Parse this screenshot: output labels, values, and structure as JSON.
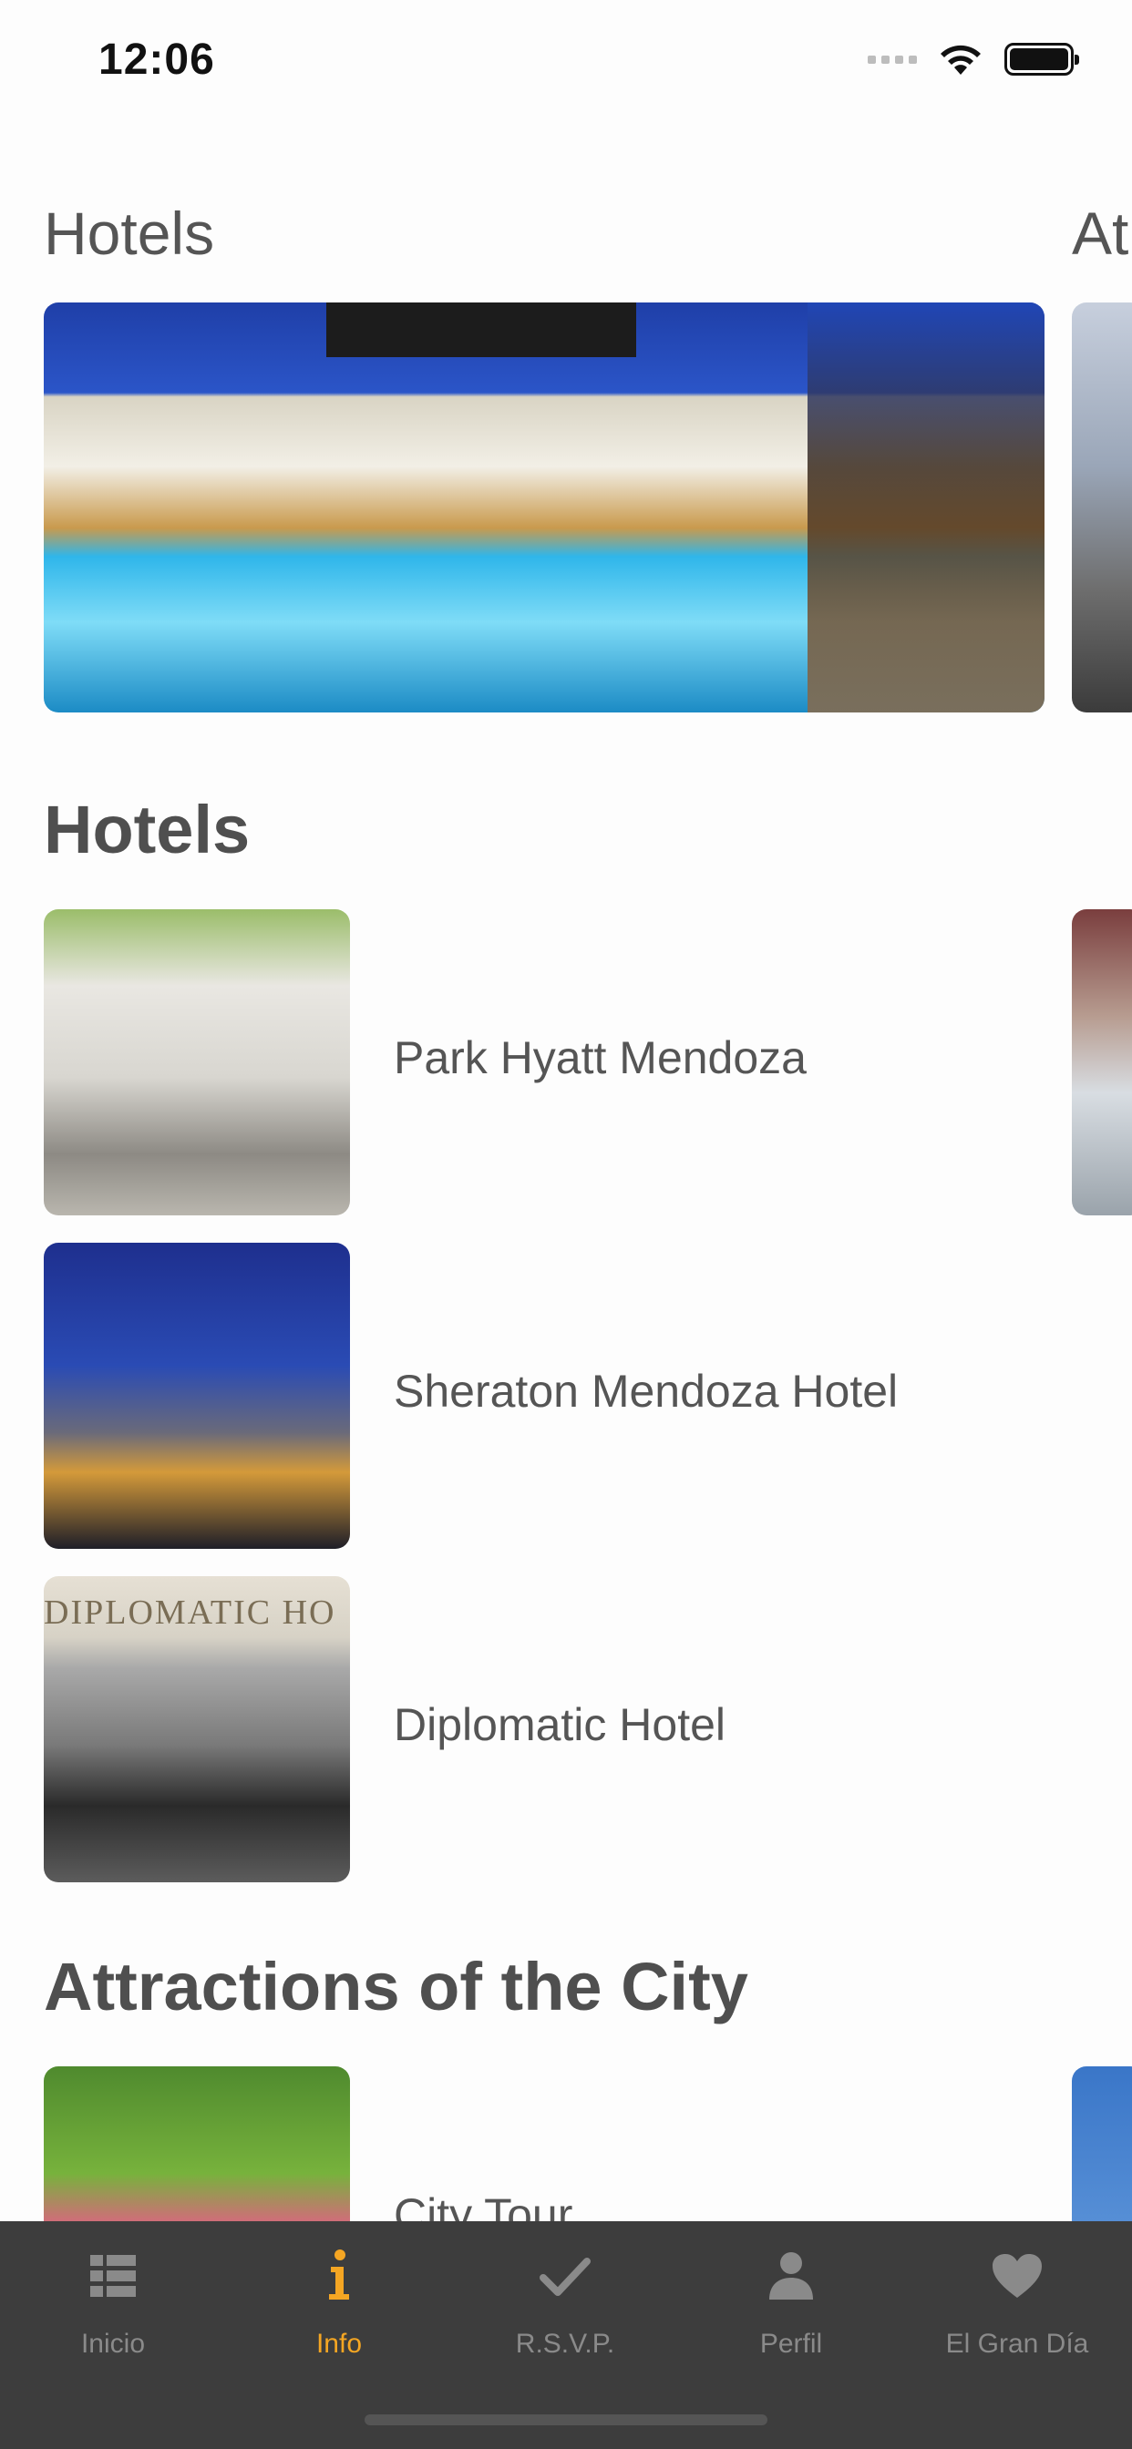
{
  "status_bar": {
    "time": "12:06"
  },
  "sections": {
    "featured_title": "Hotels",
    "featured_next_title": "At",
    "hotels_title": "Hotels",
    "attractions_title": "Attractions of the City"
  },
  "hotels": [
    {
      "name": "Park Hyatt Mendoza"
    },
    {
      "name": "Sheraton Mendoza Hotel"
    },
    {
      "name": "Diplomatic Hotel",
      "sign_text": "DIPLOMATIC HO"
    }
  ],
  "attractions": [
    {
      "name": "City Tour"
    }
  ],
  "tab_bar": {
    "active_color": "#f5a623",
    "inactive_color": "#8a8a8a",
    "tabs": [
      {
        "label": "Inicio",
        "icon": "list-icon"
      },
      {
        "label": "Info",
        "icon": "info-icon",
        "active": true
      },
      {
        "label": "R.S.V.P.",
        "icon": "checkmark-icon"
      },
      {
        "label": "Perfil",
        "icon": "person-icon"
      },
      {
        "label": "El Gran Día",
        "icon": "heart-icon"
      }
    ]
  }
}
